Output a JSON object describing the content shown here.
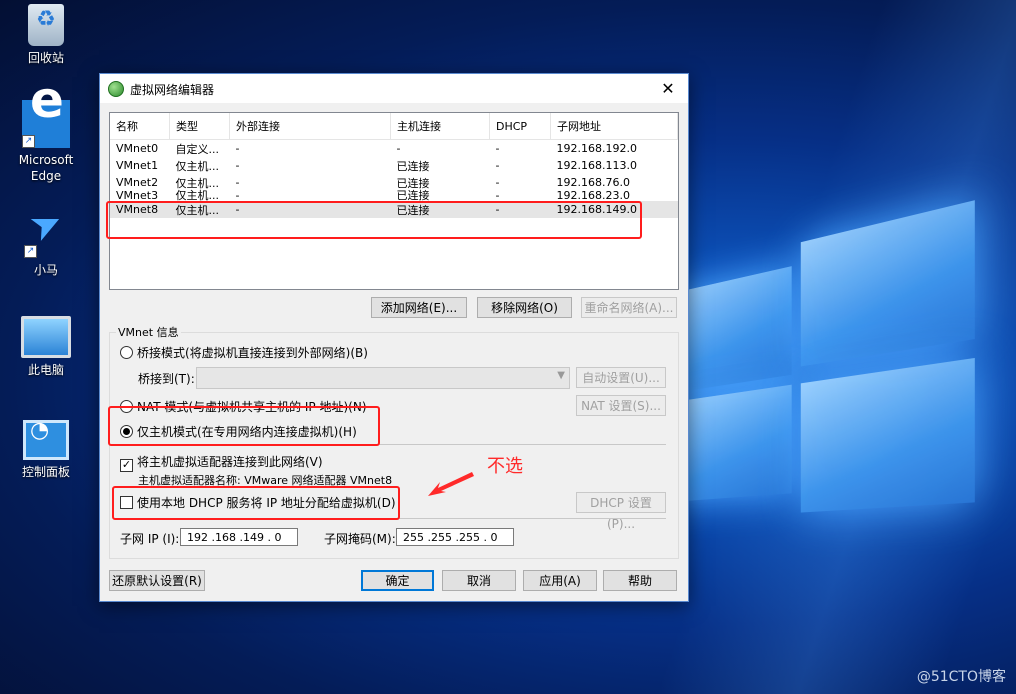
{
  "desktop": {
    "icons": [
      {
        "label": "回收站"
      },
      {
        "label": "Microsoft Edge"
      },
      {
        "label": "小马"
      },
      {
        "label": "此电脑"
      },
      {
        "label": "控制面板"
      }
    ]
  },
  "dialog": {
    "title": "虚拟网络编辑器",
    "close_glyph": "✕",
    "columns": [
      "名称",
      "类型",
      "外部连接",
      "主机连接",
      "DHCP",
      "子网地址"
    ],
    "rows": [
      [
        "VMnet0",
        "自定义...",
        "-",
        "-",
        "-",
        "192.168.192.0"
      ],
      [
        "VMnet1",
        "仅主机...",
        "-",
        "已连接",
        "-",
        "192.168.113.0"
      ],
      [
        "VMnet2",
        "仅主机...",
        "-",
        "已连接",
        "-",
        "192.168.76.0"
      ],
      [
        "VMnet3",
        "仅主机...",
        "-",
        "已连接",
        "-",
        "192.168.23.0"
      ],
      [
        "VMnet8",
        "仅主机...",
        "-",
        "已连接",
        "-",
        "192.168.149.0"
      ]
    ],
    "list_buttons": {
      "add": "添加网络(E)...",
      "remove": "移除网络(O)",
      "rename": "重命名网络(A)..."
    },
    "vmnet_info": {
      "group_label": "VMnet 信息",
      "bridged": "桥接模式(将虚拟机直接连接到外部网络)(B)",
      "bridge_to_label": "桥接到(T):",
      "auto_button": "自动设置(U)...",
      "nat": "NAT 模式(与虚拟机共享主机的 IP 地址)(N)",
      "nat_button": "NAT 设置(S)...",
      "host_only": "仅主机模式(在专用网络内连接虚拟机)(H)",
      "connect_adapter": "将主机虚拟适配器连接到此网络(V)",
      "adapter_name": "主机虚拟适配器名称: VMware 网络适配器 VMnet8",
      "use_dhcp": "使用本地 DHCP 服务将 IP 地址分配给虚拟机(D)",
      "dhcp_button": "DHCP 设置(P)..."
    },
    "subnet": {
      "ip_label": "子网 IP (I):",
      "ip_value": "192 .168 .149 . 0",
      "mask_label": "子网掩码(M):",
      "mask_value": "255 .255 .255 . 0"
    },
    "footer": {
      "restore": "还原默认设置(R)",
      "ok": "确定",
      "cancel": "取消",
      "apply": "应用(A)",
      "help": "帮助"
    }
  },
  "annotation": {
    "note": "不选"
  },
  "watermark": "@51CTO博客"
}
